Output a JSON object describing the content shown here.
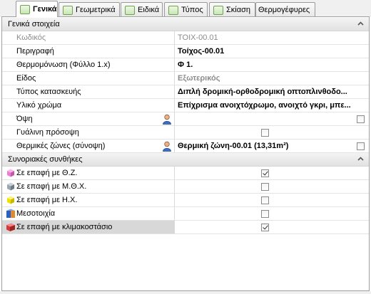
{
  "tabs": [
    {
      "label": "Γενικά",
      "active": true
    },
    {
      "label": "Γεωμετρικά",
      "active": false
    },
    {
      "label": "Ειδικά",
      "active": false
    },
    {
      "label": "Τύπος",
      "active": false
    },
    {
      "label": "Σκίαση",
      "active": false
    },
    {
      "label": "Θερμογέφυρες",
      "active": false
    }
  ],
  "general": {
    "header": "Γενικά στοιχεία",
    "rows": [
      {
        "name": "Κωδικός",
        "value": "TOIX-00.01"
      },
      {
        "name": "Περιγραφή",
        "value": "Τοίχος-00.01"
      },
      {
        "name": "Θερμομόνωση (Φύλλο 1.x)",
        "value": "Φ 1."
      },
      {
        "name": "Είδος",
        "value": "Εξωτερικός"
      },
      {
        "name": "Τύπος κατασκευής",
        "value": "Διπλή δρομική-ορθοδρομική οπτοπλινθοδο..."
      },
      {
        "name": "Υλικό χρώμα",
        "value": "Επίχρισμα ανοιχτόχρωμο, ανοιχτό γκρι, μπε..."
      },
      {
        "name": "Όψη",
        "value": ""
      },
      {
        "name": "Γυάλινη πρόσοψη",
        "value": ""
      },
      {
        "name": "Θερμικές ζώνες (σύνοψη)",
        "value": "Θερμική ζώνη-00.01 (13,31m²)"
      }
    ]
  },
  "boundary": {
    "header": "Συνοριακές συνθήκες",
    "rows": [
      {
        "name": "Σε επαφή με Θ.Ζ.",
        "checked": true,
        "icon": "pink-zone-icon",
        "color": "#e97fd0"
      },
      {
        "name": "Σε επαφή με Μ.Θ.Χ.",
        "checked": false,
        "icon": "gray-zone-icon",
        "color": "#9aa4ad"
      },
      {
        "name": "Σε επαφή με Η.Χ.",
        "checked": false,
        "icon": "yellow-zone-icon",
        "color": "#f0e000"
      },
      {
        "name": "Μεσοτοιχία",
        "checked": false,
        "icon": "party-wall-icon",
        "color": "#2a62c9"
      },
      {
        "name": "Σε επαφή με κλιμακοστάσιο",
        "checked": true,
        "icon": "staircase-icon",
        "color": "#d33a3a"
      }
    ]
  }
}
